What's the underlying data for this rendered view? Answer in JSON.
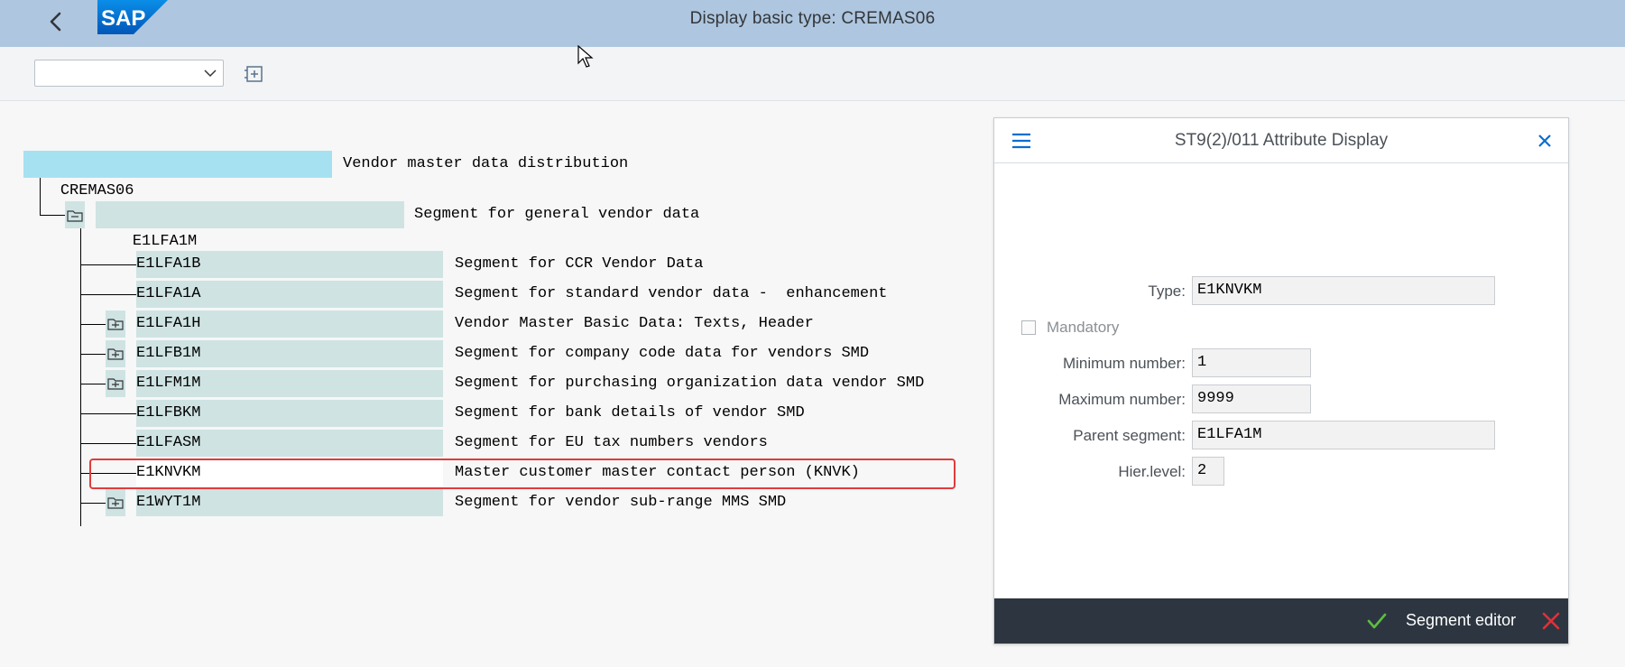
{
  "header": {
    "title": "Display basic type: CREMAS06",
    "logo_text": "SAP"
  },
  "toolbar": {
    "dropdown_value": ""
  },
  "tree": {
    "root": {
      "name": "CREMAS06",
      "description": "Vendor master data distribution"
    },
    "level1": {
      "name": "E1LFA1M",
      "description": "Segment for general vendor data"
    },
    "children": [
      {
        "name": "E1LFA1B",
        "description": "Segment for CCR Vendor Data",
        "folder": false
      },
      {
        "name": "E1LFA1A",
        "description": "Segment for standard vendor data -  enhancement",
        "folder": false
      },
      {
        "name": "E1LFA1H",
        "description": "Vendor Master Basic Data: Texts, Header",
        "folder": true
      },
      {
        "name": "E1LFB1M",
        "description": "Segment for company code data for vendors SMD",
        "folder": true
      },
      {
        "name": "E1LFM1M",
        "description": "Segment for purchasing organization data vendor SMD",
        "folder": true
      },
      {
        "name": "E1LFBKM",
        "description": "Segment for bank details of vendor SMD",
        "folder": false
      },
      {
        "name": "E1LFASM",
        "description": "Segment for EU tax numbers vendors",
        "folder": false
      },
      {
        "name": "E1KNVKM",
        "description": "Master customer master contact person (KNVK)",
        "folder": false,
        "selected": true
      },
      {
        "name": "E1WYT1M",
        "description": "Segment for vendor sub-range MMS SMD",
        "folder": true
      }
    ]
  },
  "dialog": {
    "title": "ST9(2)/011 Attribute Display",
    "type_label": "Type:",
    "type_value": "E1KNVKM",
    "mandatory_label": "Mandatory",
    "min_label": "Minimum number:",
    "min_value": "1",
    "max_label": "Maximum number:",
    "max_value": "9999",
    "parent_label": "Parent segment:",
    "parent_value": "E1LFA1M",
    "hier_label": "Hier.level:",
    "hier_value": "2",
    "footer_label": "Segment editor"
  },
  "colors": {
    "header_bg": "#aec6df",
    "tree_cell": "#cfe3e3",
    "root_cell": "#a6e1f1",
    "highlight": "#e03c3c",
    "footer_bg": "#2d3640"
  }
}
